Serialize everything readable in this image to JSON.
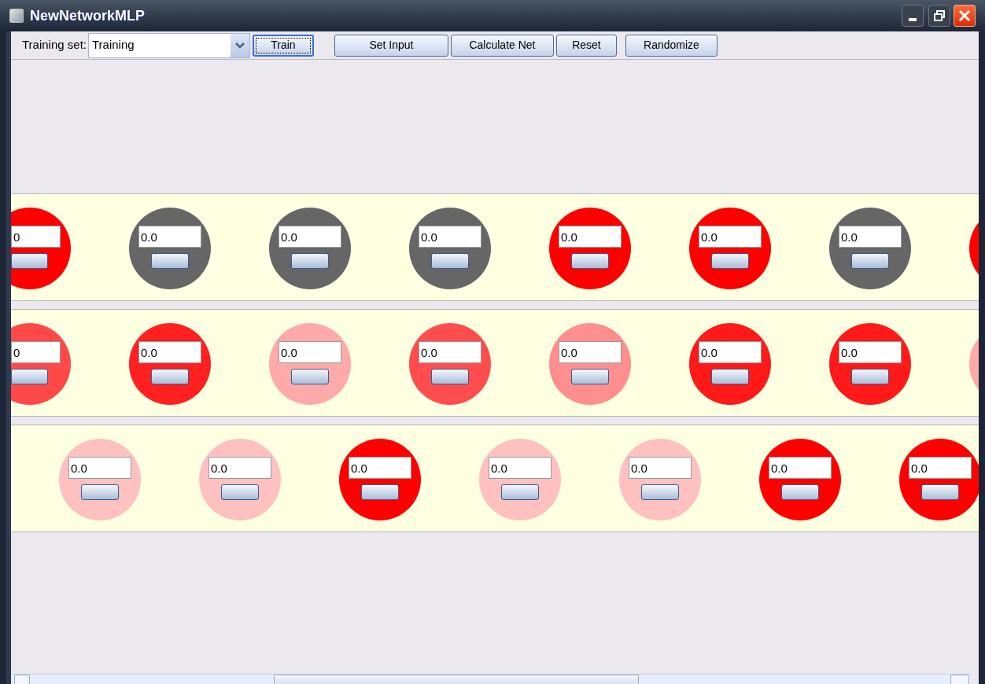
{
  "window": {
    "title": "NewNetworkMLP"
  },
  "toolbar": {
    "label": "Training set:",
    "combo_value": "Training",
    "buttons": [
      {
        "label": "Train",
        "focused": true
      },
      {
        "label": "Set Input",
        "focused": false
      },
      {
        "label": "Calculate Net",
        "focused": false
      },
      {
        "label": "Reset",
        "focused": false
      },
      {
        "label": "Randomize",
        "focused": false
      }
    ]
  },
  "layers": [
    {
      "neurons": [
        {
          "kind": "cut-left",
          "color": "#ff0000",
          "value": "0"
        },
        {
          "kind": "full",
          "color": "#666666",
          "value": "0.0"
        },
        {
          "kind": "full",
          "color": "#666666",
          "value": "0.0"
        },
        {
          "kind": "full",
          "color": "#666666",
          "value": "0.0"
        },
        {
          "kind": "full",
          "color": "#ff0000",
          "value": "0.0"
        },
        {
          "kind": "full",
          "color": "#ff0000",
          "value": "0.0"
        },
        {
          "kind": "full",
          "color": "#666666",
          "value": "0.0"
        },
        {
          "kind": "cut-right",
          "color": "#ff0000"
        }
      ]
    },
    {
      "neurons": [
        {
          "kind": "cut-left",
          "color": "#ff4848",
          "value": "0"
        },
        {
          "kind": "full",
          "color": "#ff2020",
          "value": "0.0"
        },
        {
          "kind": "full",
          "color": "#ffaaaa",
          "value": "0.0"
        },
        {
          "kind": "full",
          "color": "#ff4d4d",
          "value": "0.0"
        },
        {
          "kind": "full",
          "color": "#ff8e8e",
          "value": "0.0"
        },
        {
          "kind": "full",
          "color": "#ff1a1a",
          "value": "0.0"
        },
        {
          "kind": "full",
          "color": "#ff1a1a",
          "value": "0.0"
        },
        {
          "kind": "cut-right",
          "color": "#ffaaaa"
        }
      ]
    },
    {
      "neurons": [
        {
          "kind": "full",
          "color": "#ffc0c0",
          "value": "0.0"
        },
        {
          "kind": "full",
          "color": "#ffc0c0",
          "value": "0.0"
        },
        {
          "kind": "full",
          "color": "#ff0000",
          "value": "0.0"
        },
        {
          "kind": "full",
          "color": "#ffc0c0",
          "value": "0.0"
        },
        {
          "kind": "full",
          "color": "#ffc0c0",
          "value": "0.0"
        },
        {
          "kind": "full",
          "color": "#ff0000",
          "value": "0.0"
        },
        {
          "kind": "full",
          "color": "#ff0000",
          "value": "0.0"
        }
      ]
    }
  ]
}
